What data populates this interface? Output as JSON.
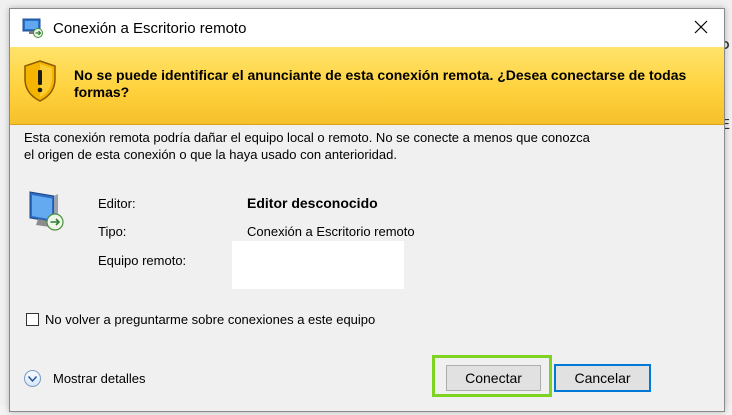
{
  "window": {
    "title": "Conexión a Escritorio remoto",
    "close_icon": "close-icon"
  },
  "warning": {
    "icon": "shield-warning-icon",
    "text": "No se puede identificar el anunciante de esta conexión remota. ¿Desea conectarse de todas formas?",
    "accent": "#ffd23d"
  },
  "description": {
    "line1": "Esta conexión remota podría dañar el equipo local o remoto. No se conecte a menos que conozca",
    "line2": "el origen de esta conexión o que la haya usado con anterioridad."
  },
  "details": {
    "icon": "remote-computer-icon",
    "editor_label": "Editor:",
    "editor_value": "Editor desconocido",
    "type_label": "Tipo:",
    "type_value": "Conexión a Escritorio remoto",
    "remote_label": "Equipo remoto:"
  },
  "checkbox": {
    "label": "No volver a preguntarme sobre conexiones a este equipo",
    "checked": false
  },
  "footer": {
    "show_details": "Mostrar detalles",
    "connect_button": "Conectar",
    "cancel_button": "Cancelar",
    "connect_highlight": "#7ed321",
    "cancel_focus": "#0078d7"
  },
  "background": {
    "right_char_1": "P",
    "right_char_2": "E"
  }
}
